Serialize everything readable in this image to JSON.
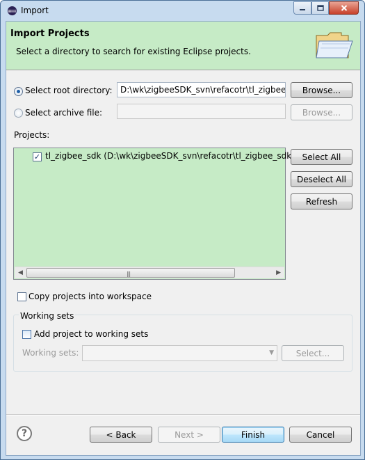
{
  "window": {
    "title": "Import",
    "icon": "eclipse-icon",
    "controls": {
      "minimize": "minimize-icon",
      "maximize": "maximize-icon",
      "close": "close-icon"
    }
  },
  "banner": {
    "title": "Import Projects",
    "description": "Select a directory to search for existing Eclipse projects.",
    "icon": "folder-icon"
  },
  "source": {
    "root_directory_label": "Select root directory:",
    "root_directory_value": "D:\\wk\\zigbeeSDK_svn\\refacotr\\tl_zigbee_",
    "root_directory_selected": true,
    "archive_file_label": "Select archive file:",
    "archive_file_value": "",
    "browse_label": "Browse...",
    "browse_archive_label": "Browse..."
  },
  "projects": {
    "label": "Projects:",
    "items": [
      {
        "checked": true,
        "text": "tl_zigbee_sdk (D:\\wk\\zigbeeSDK_svn\\refacotr\\tl_zigbee_sdk)"
      }
    ],
    "select_all_label": "Select All",
    "deselect_all_label": "Deselect All",
    "refresh_label": "Refresh"
  },
  "options": {
    "copy_into_workspace_label": "Copy projects into workspace",
    "copy_into_workspace_checked": false
  },
  "working_sets": {
    "group_title": "Working sets",
    "add_to_working_sets_label": "Add project to working sets",
    "add_to_working_sets_checked": false,
    "working_sets_label": "Working sets:",
    "working_sets_value": "",
    "select_label": "Select..."
  },
  "footer": {
    "help_icon": "help-icon",
    "back_label": "< Back",
    "next_label": "Next >",
    "finish_label": "Finish",
    "cancel_label": "Cancel"
  },
  "colors": {
    "banner_background": "#c6ebc6",
    "list_background": "#c6ebc6",
    "window_frame": "#c7dbef",
    "dialog_background": "#f0f0f0"
  }
}
